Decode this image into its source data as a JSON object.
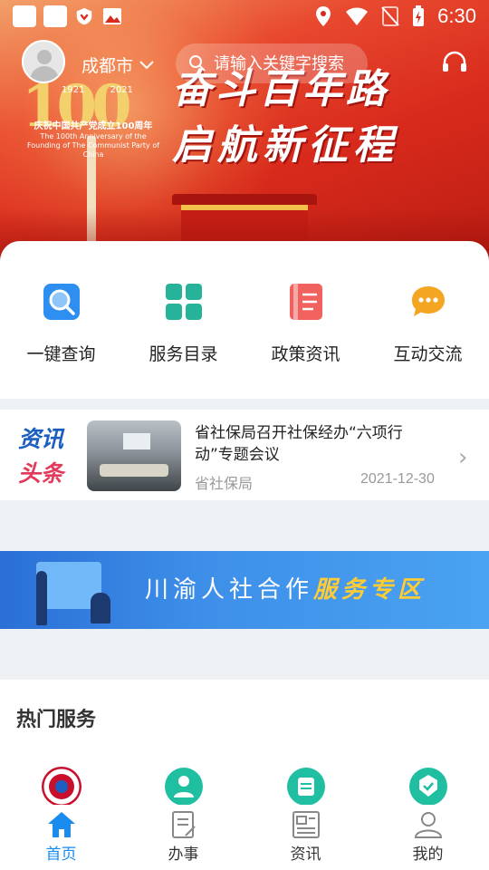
{
  "status_bar": {
    "time": "6:30"
  },
  "header": {
    "city": "成都市",
    "search_placeholder": "请输入关键字搜索"
  },
  "banner": {
    "centennial_number": "100",
    "years": [
      "1921",
      "2021"
    ],
    "caption_cn": "庆祝中国共产党成立100周年",
    "caption_en": "The 100th Anniversary of the Founding of The Communist Party of China",
    "slogan_line1": "奋斗百年路",
    "slogan_line2": "启航新征程"
  },
  "quick_actions": [
    {
      "label": "一键查询",
      "icon": "search-icon",
      "color": "#2f8ff0"
    },
    {
      "label": "服务目录",
      "icon": "grid-icon",
      "color": "#27b39a"
    },
    {
      "label": "政策资讯",
      "icon": "document-icon",
      "color": "#f1625f"
    },
    {
      "label": "互动交流",
      "icon": "chat-icon",
      "color": "#f4a623"
    }
  ],
  "news": {
    "tag_line1": "资讯",
    "tag_line2": "头条",
    "title": "省社保局召开社保经办“六项行动”专题会议",
    "source": "省社保局",
    "date": "2021-12-30"
  },
  "coop_banner": {
    "text_plain": "川渝人社合作",
    "text_highlight": "服务专区"
  },
  "hot_services": {
    "title": "热门服务",
    "icons": [
      "emblem-icon",
      "user-service-icon",
      "calendar-service-icon",
      "badge-service-icon"
    ]
  },
  "bottom_nav": [
    {
      "label": "首页",
      "icon": "home-icon",
      "active": true
    },
    {
      "label": "办事",
      "icon": "task-icon",
      "active": false
    },
    {
      "label": "资讯",
      "icon": "news-icon",
      "active": false
    },
    {
      "label": "我的",
      "icon": "profile-icon",
      "active": false
    }
  ],
  "colors": {
    "accent_blue": "#1a8cf0",
    "news_tag_blue": "#1a5fbf",
    "news_tag_red": "#e23a5a",
    "highlight_yellow": "#ffcc33"
  }
}
